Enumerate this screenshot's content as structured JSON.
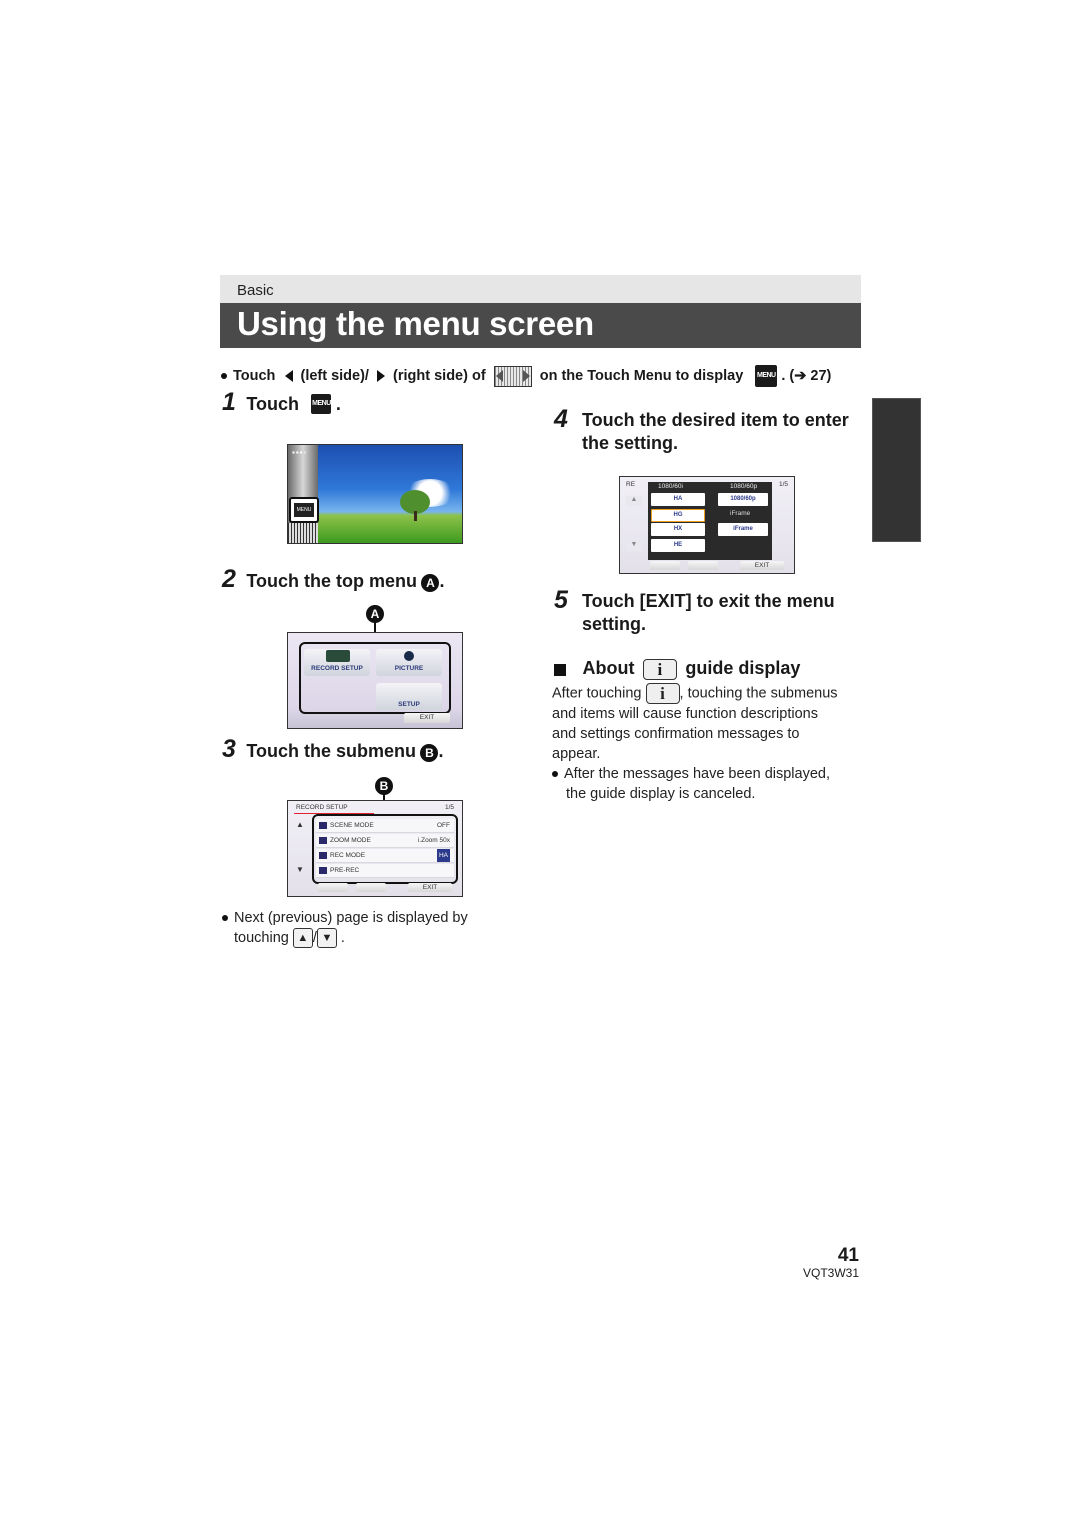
{
  "header": {
    "section": "Basic",
    "title": "Using the menu screen"
  },
  "note": {
    "prefix": "Touch",
    "left_side": "(left side)/",
    "right_side": "(right side) of",
    "suffix": "on the Touch Menu to display",
    "ref": ". (➔ 27)",
    "icons": [
      "left-triangle-icon",
      "right-triangle-icon",
      "touch-menu-strip-icon",
      "menu-icon"
    ]
  },
  "steps": [
    {
      "num": "1",
      "text": "Touch",
      "suffix": ".",
      "icon": "menu-icon"
    },
    {
      "num": "2",
      "text": "Touch the top menu",
      "marker": "A",
      "suffix": "."
    },
    {
      "num": "3",
      "text": "Touch the submenu",
      "marker": "B",
      "suffix": "."
    },
    {
      "num": "4",
      "text_line1": "Touch the desired item to enter",
      "text_line2": "the setting."
    },
    {
      "num": "5",
      "text_line1": "Touch [EXIT] to exit the menu",
      "text_line2": "setting."
    }
  ],
  "menu_icon_label": "MENU",
  "screen1": {
    "dots": "▪▪▪▫",
    "menu_button": "MENU"
  },
  "screen2": {
    "marker": "A",
    "tiles": [
      "RECORD SETUP",
      "PICTURE",
      "SETUP"
    ],
    "exit": "EXIT"
  },
  "screen3": {
    "marker": "B",
    "header": "RECORD SETUP",
    "page": "1/5",
    "rows": [
      {
        "icon": "SCN",
        "label": "SCENE MODE",
        "value": "OFF"
      },
      {
        "icon": "zoom",
        "label": "ZOOM MODE",
        "value": "i.Zoom 50x"
      },
      {
        "icon": "rec",
        "label": "REC MODE",
        "value": "HA"
      },
      {
        "icon": "RE",
        "label": "PRE-REC",
        "value": ""
      }
    ],
    "exit": "EXIT"
  },
  "screen4": {
    "header_partial": "RE",
    "col1_title": "1080/60i",
    "col2_title": "1080/60p",
    "page": "1/5",
    "col1_options": [
      "HA",
      "HG",
      "HX",
      "HE"
    ],
    "col2_options": [
      "1080/60p",
      "iFrame"
    ],
    "col2_label": "iFrame",
    "exit": "EXIT"
  },
  "next_page_note": {
    "line1": "Next (previous) page is displayed by",
    "line2_prefix": "touching",
    "sep": "/",
    "end": ".",
    "up_icon": "▲",
    "down_icon": "▼"
  },
  "guide": {
    "heading_prefix": "About",
    "heading_suffix": "guide display",
    "info_glyph": "i",
    "para_prefix": "After touching",
    "para_line1_suffix": ", touching the submenus",
    "para_line2": "and items will cause function descriptions",
    "para_line3": "and settings confirmation messages to",
    "para_line4": "appear.",
    "bullet_line1": "After the messages have been displayed,",
    "bullet_line2": "the guide display is canceled."
  },
  "footer": {
    "page_number": "41",
    "model_code": "VQT3W31"
  },
  "colors": {
    "title_bar": "#4a4a4a",
    "section_bar": "#e6e6e6",
    "side_tab": "#333333"
  }
}
